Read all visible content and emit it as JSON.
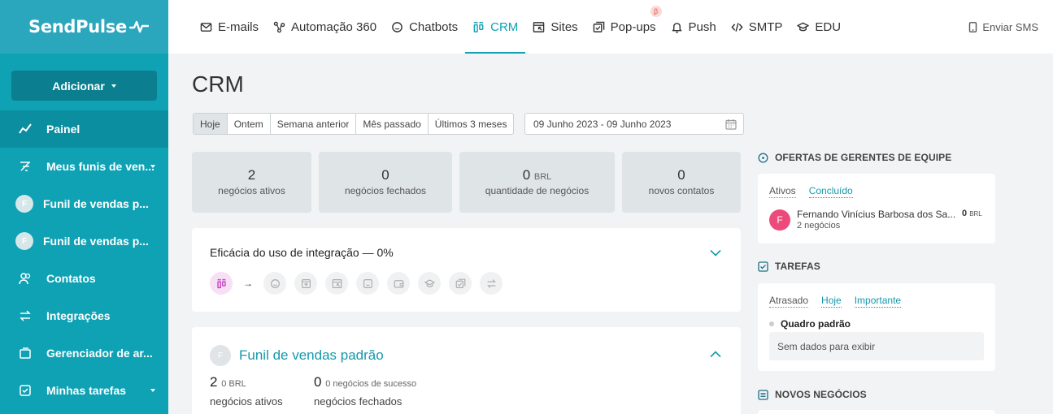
{
  "app": {
    "logo": "SendPulse"
  },
  "sidebar": {
    "add_button": "Adicionar",
    "items": [
      {
        "label": "Painel"
      },
      {
        "label": "Meus funis de ven..."
      },
      {
        "label": "Funil de vendas p...",
        "avatar": "F"
      },
      {
        "label": "Funil de vendas p...",
        "avatar": "F"
      },
      {
        "label": "Contatos"
      },
      {
        "label": "Integrações"
      },
      {
        "label": "Gerenciador de ar..."
      },
      {
        "label": "Minhas tarefas"
      }
    ]
  },
  "topnav": {
    "tabs": [
      {
        "label": "E-mails",
        "icon": "mail-icon"
      },
      {
        "label": "Automação 360",
        "icon": "automation-icon"
      },
      {
        "label": "Chatbots",
        "icon": "chat-icon"
      },
      {
        "label": "CRM",
        "icon": "crm-icon"
      },
      {
        "label": "Sites",
        "icon": "sites-icon"
      },
      {
        "label": "Pop-ups",
        "icon": "popup-icon",
        "badge": "β"
      },
      {
        "label": "Push",
        "icon": "bell-icon"
      },
      {
        "label": "SMTP",
        "icon": "code-icon"
      },
      {
        "label": "EDU",
        "icon": "graduation-icon"
      }
    ],
    "sms": "Enviar SMS"
  },
  "page": {
    "title": "CRM",
    "periods": [
      "Hoje",
      "Ontem",
      "Semana anterior",
      "Mês passado",
      "Últimos 3 meses"
    ],
    "date_range": "09 Junho 2023 - 09 Junho 2023"
  },
  "stats": [
    {
      "value": "2",
      "unit": "",
      "label": "negócios ativos"
    },
    {
      "value": "0",
      "unit": "",
      "label": "negócios fechados"
    },
    {
      "value": "0",
      "unit": "BRL",
      "label": "quantidade de negócios"
    },
    {
      "value": "0",
      "unit": "",
      "label": "novos contatos"
    }
  ],
  "efficiency": {
    "title": "Eficácia do uso de integração — 0%",
    "arrow": "→"
  },
  "funnel": {
    "avatar": "F",
    "title": "Funil de vendas padrão",
    "active_value": "2",
    "active_unit": "0 BRL",
    "active_label": "negócios ativos",
    "closed_value": "0",
    "closed_unit": "0 negócios de sucesso",
    "closed_label": "negócios fechados"
  },
  "offers": {
    "heading": "OFERTAS DE GERENTES DE EQUIPE",
    "tabs": [
      "Ativos",
      "Concluído"
    ],
    "manager": {
      "avatar": "F",
      "name": "Fernando Vinícius Barbosa dos Sa...",
      "deals": "2 negócios",
      "value": "0",
      "currency": "BRL"
    }
  },
  "tasks": {
    "heading": "TAREFAS",
    "tabs": [
      "Atrasado",
      "Hoje",
      "Importante"
    ],
    "board": "Quadro padrão",
    "empty": "Sem dados para exibir"
  },
  "new_deals": {
    "heading": "NOVOS NEGÓCIOS"
  }
}
